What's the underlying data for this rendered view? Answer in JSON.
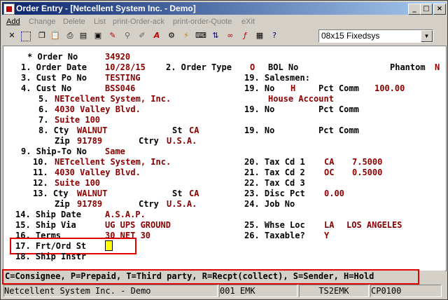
{
  "window": {
    "title": "Order Entry - [Netcellent System Inc. - Demo]"
  },
  "menu": [
    {
      "label": "Add",
      "active": true
    },
    {
      "label": "Change"
    },
    {
      "label": "Delete"
    },
    {
      "label": "List"
    },
    {
      "label": "print-Order-ack"
    },
    {
      "label": "print-order-Quote"
    },
    {
      "label": "eXit"
    }
  ],
  "toolbar": {
    "font_select": "08x15 Fixedsys",
    "icons": [
      "close-icon",
      "select-icon",
      "copy-icon",
      "paste-icon",
      "print-icon",
      "print-setup-icon",
      "copy-screen-icon",
      "edit-icon",
      "search-icon",
      "edit-text-icon",
      "font-icon",
      "config-icon",
      "lightning-icon",
      "keyboard-icon",
      "sort-icon",
      "link-icon",
      "function-icon",
      "book-icon",
      "help-icon"
    ]
  },
  "screen": {
    "order_no": {
      "label": "* Order No",
      "value": "34920"
    },
    "order_date": {
      "label": "1. Order Date",
      "value": "10/28/15"
    },
    "order_type": {
      "label": "2. Order Type",
      "value": "O"
    },
    "bol_no": {
      "label": "BOL No"
    },
    "phantom": {
      "label": "Phantom",
      "value": "N"
    },
    "cust_po": {
      "label": "3. Cust Po No",
      "value": "TESTING"
    },
    "salesmen": {
      "label": "19. Salesmen:"
    },
    "cust_no": {
      "label": "4. Cust No",
      "value": "BSS046"
    },
    "sales1": {
      "no_label": "19. No",
      "no_value": "H",
      "pct_label": "Pct Comm",
      "pct_value": "100.00",
      "name": "House Account"
    },
    "sales2": {
      "no_label": "19. No",
      "pct_label": "Pct Comm"
    },
    "sales3": {
      "no_label": "19. No",
      "pct_label": "Pct Comm"
    },
    "bill_name": {
      "label": "5.",
      "value": "NETcellent System, Inc."
    },
    "bill_addr1": {
      "label": "6.",
      "value": "4030 Valley Blvd."
    },
    "bill_addr2": {
      "label": "7.",
      "value": "Suite 100"
    },
    "bill_city": {
      "label": "8. Cty",
      "value": "WALNUT",
      "st_label": "St",
      "st_value": "CA"
    },
    "bill_zip": {
      "label": "Zip",
      "value": "91789",
      "ctry_label": "Ctry",
      "ctry_value": "U.S.A."
    },
    "ship_to": {
      "label": "9. Ship-To No",
      "value": "Same"
    },
    "ship_name": {
      "label": "10.",
      "value": "NETcellent System, Inc."
    },
    "ship_addr1": {
      "label": "11.",
      "value": "4030 Valley Blvd."
    },
    "ship_addr2": {
      "label": "12.",
      "value": "Suite 100"
    },
    "ship_city": {
      "label": "13. Cty",
      "value": "WALNUT",
      "st_label": "St",
      "st_value": "CA"
    },
    "ship_zip": {
      "label": "Zip",
      "value": "91789",
      "ctry_label": "Ctry",
      "ctry_value": "U.S.A."
    },
    "tax1": {
      "label": "20. Tax Cd 1",
      "code": "CA",
      "rate": "7.5000"
    },
    "tax2": {
      "label": "21. Tax Cd 2",
      "code": "OC",
      "rate": "0.5000"
    },
    "tax3": {
      "label": "22. Tax Cd 3"
    },
    "disc": {
      "label": "23. Disc Pct",
      "value": "0.00"
    },
    "job": {
      "label": "24. Job No"
    },
    "ship_date": {
      "label": "14. Ship Date",
      "value": "A.S.A.P."
    },
    "ship_via": {
      "label": "15. Ship Via",
      "value": "UG UPS GROUND"
    },
    "whse": {
      "label": "25. Whse Loc",
      "code": "LA",
      "name": "LOS ANGELES"
    },
    "terms": {
      "label": "16. Terms",
      "value": "30 NET 30"
    },
    "taxable": {
      "label": "26. Taxable?",
      "value": "Y"
    },
    "frt": {
      "label": "17. Frt/Ord St"
    },
    "ship_instr": {
      "label": "18. Ship Instr"
    }
  },
  "status_line": "C=Consignee, P=Prepaid, T=Third party, R=Recpt(collect), S=Sender, H=Hold",
  "bottom": {
    "company": "Netcellent System Inc. - Demo",
    "user": "001 EMK",
    "terminal": "TS2EMK",
    "program": "CP0100"
  }
}
